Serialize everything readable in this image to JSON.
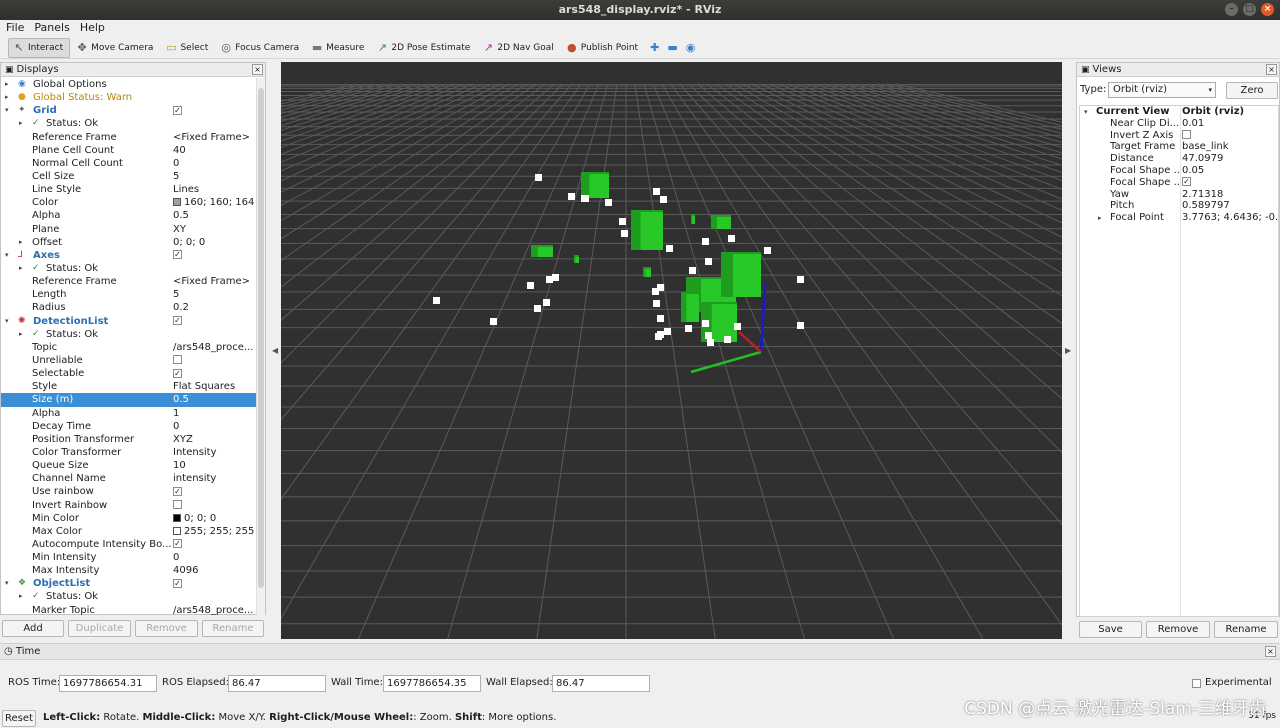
{
  "window": {
    "title": "ars548_display.rviz* - RViz"
  },
  "menu": [
    "File",
    "Panels",
    "Help"
  ],
  "toolbar": [
    {
      "label": "Interact",
      "icon": "↖",
      "active": true
    },
    {
      "label": "Move Camera",
      "icon": "✥"
    },
    {
      "label": "Select",
      "icon": "▭"
    },
    {
      "label": "Focus Camera",
      "icon": "◎"
    },
    {
      "label": "Measure",
      "icon": "▬"
    },
    {
      "label": "2D Pose Estimate",
      "icon": "↗"
    },
    {
      "label": "2D Nav Goal",
      "icon": "↗"
    },
    {
      "label": "Publish Point",
      "icon": "●"
    }
  ],
  "displays": {
    "title": "Displays",
    "rows": [
      {
        "lvl": 0,
        "arrow": "▸",
        "icon": "◉",
        "iconColor": "#4a7fc1",
        "label": "Global Options",
        "val": ""
      },
      {
        "lvl": 0,
        "arrow": "▸",
        "icon": "●",
        "iconColor": "#e0a020",
        "label": "Global Status: Warn",
        "val": "",
        "cls": "warn"
      },
      {
        "lvl": 0,
        "arrow": "▾",
        "icon": "✦",
        "iconColor": "#666",
        "label": "Grid",
        "val": "",
        "chk": "✓",
        "cls": "blue"
      },
      {
        "lvl": 1,
        "arrow": "▸",
        "icon": "✓",
        "iconColor": "#2a8a2a",
        "label": "Status: Ok",
        "val": ""
      },
      {
        "lvl": 1,
        "label": "Reference Frame",
        "val": "<Fixed Frame>"
      },
      {
        "lvl": 1,
        "label": "Plane Cell Count",
        "val": "40"
      },
      {
        "lvl": 1,
        "label": "Normal Cell Count",
        "val": "0"
      },
      {
        "lvl": 1,
        "label": "Cell Size",
        "val": "5"
      },
      {
        "lvl": 1,
        "label": "Line Style",
        "val": "Lines"
      },
      {
        "lvl": 1,
        "label": "Color",
        "val": "160; 160; 164",
        "swatch": "#a0a0a4"
      },
      {
        "lvl": 1,
        "label": "Alpha",
        "val": "0.5"
      },
      {
        "lvl": 1,
        "label": "Plane",
        "val": "XY"
      },
      {
        "lvl": 1,
        "arrow": "▸",
        "label": "Offset",
        "val": "0; 0; 0"
      },
      {
        "lvl": 0,
        "arrow": "▾",
        "icon": "⅃",
        "iconColor": "#c03030",
        "label": "Axes",
        "val": "",
        "chk": "✓",
        "cls": "blue"
      },
      {
        "lvl": 1,
        "arrow": "▸",
        "icon": "✓",
        "iconColor": "#2a8a2a",
        "label": "Status: Ok",
        "val": ""
      },
      {
        "lvl": 1,
        "label": "Reference Frame",
        "val": "<Fixed Frame>"
      },
      {
        "lvl": 1,
        "label": "Length",
        "val": "5"
      },
      {
        "lvl": 1,
        "label": "Radius",
        "val": "0.2"
      },
      {
        "lvl": 0,
        "arrow": "▾",
        "icon": "✺",
        "iconColor": "#c03030",
        "label": "DetectionList",
        "val": "",
        "chk": "✓",
        "cls": "blue"
      },
      {
        "lvl": 1,
        "arrow": "▸",
        "icon": "✓",
        "iconColor": "#2a8a2a",
        "label": "Status: Ok",
        "val": ""
      },
      {
        "lvl": 1,
        "label": "Topic",
        "val": "/ars548_proce..."
      },
      {
        "lvl": 1,
        "label": "Unreliable",
        "val": "",
        "chk": " "
      },
      {
        "lvl": 1,
        "label": "Selectable",
        "val": "",
        "chk": "✓"
      },
      {
        "lvl": 1,
        "label": "Style",
        "val": "Flat Squares"
      },
      {
        "lvl": 1,
        "label": "Size (m)",
        "val": "0.5",
        "sel": true
      },
      {
        "lvl": 1,
        "label": "Alpha",
        "val": "1"
      },
      {
        "lvl": 1,
        "label": "Decay Time",
        "val": "0"
      },
      {
        "lvl": 1,
        "label": "Position Transformer",
        "val": "XYZ"
      },
      {
        "lvl": 1,
        "label": "Color Transformer",
        "val": "Intensity"
      },
      {
        "lvl": 1,
        "label": "Queue Size",
        "val": "10"
      },
      {
        "lvl": 1,
        "label": "Channel Name",
        "val": "intensity"
      },
      {
        "lvl": 1,
        "label": "Use rainbow",
        "val": "",
        "chk": "✓"
      },
      {
        "lvl": 1,
        "label": "Invert Rainbow",
        "val": "",
        "chk": " "
      },
      {
        "lvl": 1,
        "label": "Min Color",
        "val": "0; 0; 0",
        "swatch": "#000000"
      },
      {
        "lvl": 1,
        "label": "Max Color",
        "val": "255; 255; 255",
        "swatch": "#ffffff"
      },
      {
        "lvl": 1,
        "label": "Autocompute Intensity Bo...",
        "val": "",
        "chk": "✓"
      },
      {
        "lvl": 1,
        "label": "Min Intensity",
        "val": "0"
      },
      {
        "lvl": 1,
        "label": "Max Intensity",
        "val": "4096"
      },
      {
        "lvl": 0,
        "arrow": "▾",
        "icon": "❖",
        "iconColor": "#3a9a3a",
        "label": "ObjectList",
        "val": "",
        "chk": "✓",
        "cls": "blue"
      },
      {
        "lvl": 1,
        "arrow": "▸",
        "icon": "✓",
        "iconColor": "#2a8a2a",
        "label": "Status: Ok",
        "val": ""
      },
      {
        "lvl": 1,
        "label": "Marker Topic",
        "val": "/ars548_proce..."
      }
    ],
    "buttons": [
      "Add",
      "Duplicate",
      "Remove",
      "Rename"
    ]
  },
  "views": {
    "title": "Views",
    "type_label": "Type:",
    "type_value": "Orbit (rviz)",
    "zero_label": "Zero",
    "current_view_label": "Current View",
    "current_view_value": "Orbit (rviz)",
    "props": [
      {
        "label": "Near Clip Di...",
        "val": "0.01"
      },
      {
        "label": "Invert Z Axis",
        "val": "",
        "chk": " "
      },
      {
        "label": "Target Frame",
        "val": "base_link"
      },
      {
        "label": "Distance",
        "val": "47.0979"
      },
      {
        "label": "Focal Shape ...",
        "val": "0.05"
      },
      {
        "label": "Focal Shape ...",
        "val": "",
        "chk": "✓"
      },
      {
        "label": "Yaw",
        "val": "2.71318"
      },
      {
        "label": "Pitch",
        "val": "0.589797"
      },
      {
        "label": "Focal Point",
        "val": "3.7763; 4.6436; -0....",
        "arrow": "▸"
      }
    ],
    "buttons": [
      "Save",
      "Remove",
      "Rename"
    ]
  },
  "time": {
    "title": "Time",
    "ros_time_label": "ROS Time:",
    "ros_time": "1697786654.31",
    "ros_elapsed_label": "ROS Elapsed:",
    "ros_elapsed": "86.47",
    "wall_time_label": "Wall Time:",
    "wall_time": "1697786654.35",
    "wall_elapsed_label": "Wall Elapsed:",
    "wall_elapsed": "86.47",
    "experimental": "Experimental"
  },
  "status": {
    "reset": "Reset",
    "b1": "Left-Click:",
    "t1": " Rotate. ",
    "b2": "Middle-Click:",
    "t2": " Move X/Y. ",
    "b3": "Right-Click/Mouse Wheel:",
    "t3": ": Zoom. ",
    "b4": "Shift",
    "t4": ": More options.",
    "fps": "31 fps"
  },
  "watermark": "CSDN @点云-激光雷达-Slam-三维牙齿"
}
